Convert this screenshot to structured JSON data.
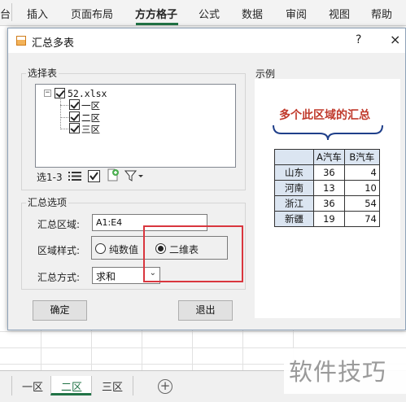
{
  "ribbon": {
    "tabs": [
      {
        "label": "台",
        "active": false
      },
      {
        "label": "插入",
        "active": false
      },
      {
        "label": "页面布局",
        "active": false
      },
      {
        "label": "方方格子",
        "active": true
      },
      {
        "label": "公式",
        "active": false
      },
      {
        "label": "数据",
        "active": false
      },
      {
        "label": "审阅",
        "active": false
      },
      {
        "label": "视图",
        "active": false
      },
      {
        "label": "帮助",
        "active": false
      }
    ],
    "accent_color": "#217346"
  },
  "dialog": {
    "title": "汇总多表",
    "help": "?",
    "close": "×",
    "select_group": {
      "label": "选择表",
      "root_label": "52.xlsx",
      "expander": "−",
      "sheets": [
        "一区",
        "二区",
        "三区"
      ],
      "selection_text": "选1-3",
      "toolbar_icons": [
        "list-icon",
        "check-all-icon",
        "refresh-icon",
        "filter-icon"
      ]
    },
    "options_group": {
      "label": "汇总选项",
      "range_label": "汇总区域:",
      "range_value": "A1:E4",
      "style_label": "区域样式:",
      "style_options": [
        {
          "label": "纯数值",
          "checked": false
        },
        {
          "label": "二维表",
          "checked": true
        }
      ],
      "method_label": "汇总方式:",
      "method_value": "求和"
    },
    "example": {
      "label": "示例",
      "title": "多个此区域的汇总",
      "header": [
        "",
        "A汽车",
        "B汽车"
      ],
      "rows": [
        [
          "山东",
          "36",
          "4"
        ],
        [
          "河南",
          "13",
          "10"
        ],
        [
          "浙江",
          "36",
          "54"
        ],
        [
          "新疆",
          "19",
          "74"
        ]
      ]
    },
    "ok_button": "确定",
    "exit_button": "退出"
  },
  "sheet_tabs": [
    {
      "label": "一区",
      "active": false
    },
    {
      "label": "二区",
      "active": true
    },
    {
      "label": "三区",
      "active": false
    }
  ],
  "add_sheet": "+",
  "watermark": "软件技巧"
}
